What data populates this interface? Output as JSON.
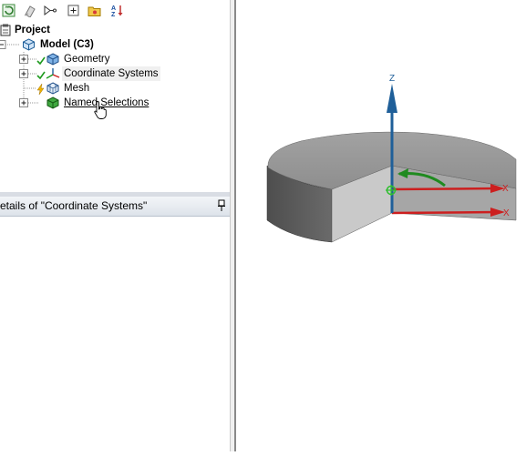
{
  "toolbar": {
    "icons": [
      "refresh-icon",
      "clear-icon",
      "filter-icon",
      "expand-all-icon",
      "folder-icon",
      "sort-az-icon"
    ]
  },
  "tree": {
    "root": "Project",
    "model": "Model (C3)",
    "items": [
      {
        "label": "Geometry",
        "icon": "geometry-icon",
        "state": "check"
      },
      {
        "label": "Coordinate Systems",
        "icon": "coordinate-systems-icon",
        "state": "check"
      },
      {
        "label": "Mesh",
        "icon": "mesh-icon",
        "state": "lightning"
      },
      {
        "label": "Named Selections",
        "icon": "named-selections-icon",
        "state": "none"
      }
    ]
  },
  "details": {
    "title": "etails of \"Coordinate Systems\""
  },
  "viewport": {
    "axis_z_label": "Z",
    "axis_x_label_1": "X",
    "axis_x_label_2": "X",
    "colors": {
      "z_axis": "#1f5f99",
      "x_axis": "#cc1f1f",
      "rotation": "#1f8a1f"
    }
  }
}
